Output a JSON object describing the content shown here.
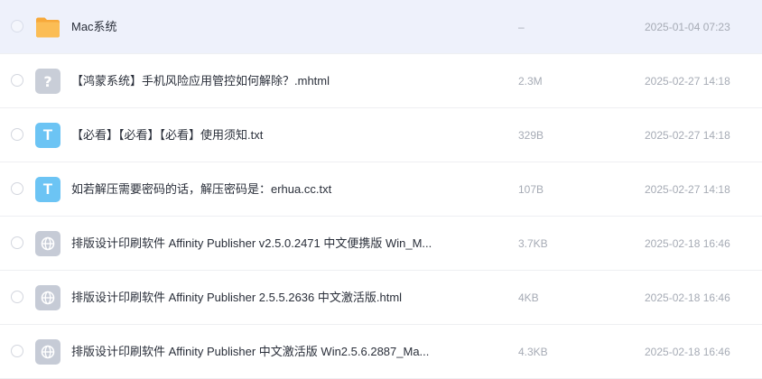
{
  "files": [
    {
      "name": "Mac系统",
      "size": "–",
      "date": "2025-01-04 07:23",
      "icon": "folder-icon",
      "selected": true
    },
    {
      "name": "【鸿蒙系统】手机风险应用管控如何解除？.mhtml",
      "size": "2.3M",
      "date": "2025-02-27 14:18",
      "icon": "unknown-file-icon",
      "glyph": "?"
    },
    {
      "name": "【必看】【必看】【必看】使用须知.txt",
      "size": "329B",
      "date": "2025-02-27 14:18",
      "icon": "text-file-icon",
      "glyph": "T"
    },
    {
      "name": "如若解压需要密码的话，解压密码是：erhua.cc.txt",
      "size": "107B",
      "date": "2025-02-27 14:18",
      "icon": "text-file-icon",
      "glyph": "T"
    },
    {
      "name": "排版设计印刷软件 Affinity Publisher v2.5.0.2471 中文便携版 Win_M...",
      "size": "3.7KB",
      "date": "2025-02-18 16:46",
      "icon": "web-file-icon"
    },
    {
      "name": "排版设计印刷软件 Affinity Publisher 2.5.5.2636 中文激活版.html",
      "size": "4KB",
      "date": "2025-02-18 16:46",
      "icon": "web-file-icon"
    },
    {
      "name": "排版设计印刷软件 Affinity Publisher 中文激活版 Win2.5.6.2887_Ma...",
      "size": "4.3KB",
      "date": "2025-02-18 16:46",
      "icon": "web-file-icon"
    }
  ],
  "colors": {
    "selected_row": "#eef1fb",
    "folder": "#f9b94b",
    "text_file": "#6cc4f4",
    "generic_file": "#c9ced8"
  }
}
